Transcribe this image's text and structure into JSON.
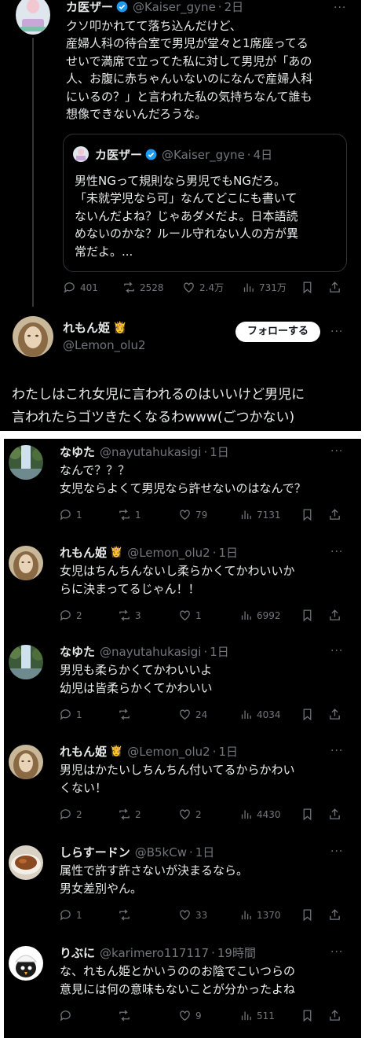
{
  "top": {
    "original": {
      "name": "カ医ザー",
      "handle": "@Kaiser_gyne",
      "time": "2日",
      "text": "クソ叩かれてて落ち込んだけど、\n産婦人科の待合室で男児が堂々と1席座ってる\nせいで満席で立ってた私に対して男児が「あの\n人、お腹に赤ちゃんいないのになんで産婦人科\nにいるの？」と言われた私の気持ちなんて誰も\n想像できないんだろうな。",
      "quote": {
        "name": "カ医ザー",
        "handle": "@Kaiser_gyne",
        "time": "4日",
        "text": "男性NGって規則なら男児でもNGだろ。\n「未就学児なら可」なんてどこにも書いて\nないんだよね？じゃあダメだよ。日本語読\nめないのかな？ルール守れない人の方が異\n常だよ。..."
      },
      "stats": {
        "replies": "401",
        "reposts": "2528",
        "likes": "2.4万",
        "views": "731万"
      }
    },
    "reply": {
      "name": "れもん姫",
      "emoji": "👸",
      "handle": "@Lemon_olu2",
      "follow_label": "フォローする",
      "text": "わたしはこれ女児に言われるのはいいけど男児に\n言われたらゴツきたくなるわwww(ごつかない)"
    }
  },
  "replies": [
    {
      "name": "なゆた",
      "handle": "@nayutahukasigi",
      "time": "1日",
      "avatar": "waterfall",
      "text": "なんで？？？\n女児ならよくて男児なら許せないのはなんで？",
      "replies": "1",
      "reposts": "1",
      "likes": "79",
      "views": "7131"
    },
    {
      "name": "れもん姫",
      "emoji": "👸",
      "handle": "@Lemon_olu2",
      "time": "1日",
      "avatar": "lemon",
      "text": "女児はちんちんないし柔らかくてかわいいか\nらに決まってるじゃん！！",
      "replies": "2",
      "reposts": "3",
      "likes": "1",
      "views": "6992"
    },
    {
      "name": "なゆた",
      "handle": "@nayutahukasigi",
      "time": "1日",
      "avatar": "waterfall",
      "text": "男児も柔らかくてかわいいよ\n幼児は皆柔らかくてかわいい",
      "replies": "1",
      "reposts": "",
      "likes": "24",
      "views": "4034"
    },
    {
      "name": "れもん姫",
      "emoji": "👸",
      "handle": "@Lemon_olu2",
      "time": "1日",
      "avatar": "lemon",
      "text": "男児はかたいしちんちん付いてるからかわい\nくない！",
      "replies": "2",
      "reposts": "2",
      "likes": "2",
      "views": "4430"
    },
    {
      "name": "しらすードン",
      "handle": "@B5kCw",
      "time": "1日",
      "avatar": "food",
      "text": "属性で許す許さないが決まるなら。\n男女差別やん。",
      "replies": "1",
      "reposts": "",
      "likes": "33",
      "views": "1370"
    },
    {
      "name": "りぶに",
      "handle": "@karimero117117",
      "time": "19時間",
      "avatar": "chick",
      "text": "な、れもん姫とかいうののお陰でこいつらの\n意見には何の意味もないことが分かったよね",
      "replies": "",
      "reposts": "",
      "likes": "9",
      "views": "511"
    }
  ],
  "icons": [
    "reply-icon",
    "repost-icon",
    "like-icon",
    "views-icon",
    "bookmark-icon",
    "share-icon",
    "more-icon",
    "verified-badge"
  ],
  "colors": {
    "background": "#000000",
    "text": "#e7e9ea",
    "muted": "#71767b",
    "verified": "#1d9bf0",
    "border": "#2f3336"
  }
}
